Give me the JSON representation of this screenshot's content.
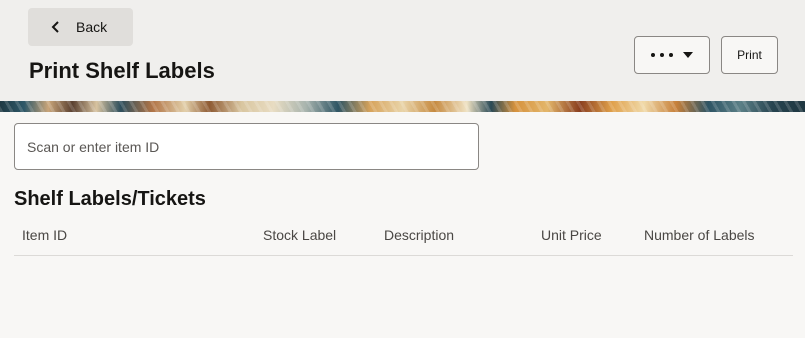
{
  "header": {
    "back_label": "Back",
    "title": "Print Shelf Labels",
    "more_button_icon": "more-options-icon",
    "print_label": "Print"
  },
  "search": {
    "placeholder": "Scan or enter item ID",
    "value": ""
  },
  "labels_section": {
    "title": "Shelf Labels/Tickets",
    "columns": [
      "Item ID",
      "Stock Label",
      "Description",
      "Unit Price",
      "Number of Labels"
    ],
    "rows": []
  }
}
